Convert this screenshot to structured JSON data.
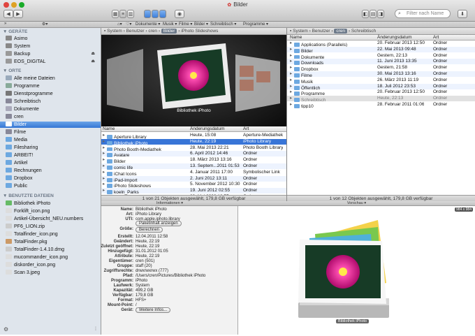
{
  "window": {
    "title": "Bilder"
  },
  "toolbar": {
    "back": "◀",
    "forward": "▶",
    "search_placeholder": "Filter nach Name"
  },
  "favbar": {
    "items": [
      "Dokumente ▾",
      "Musik ▾",
      "Filme ▾",
      "Bilder ▾",
      "Schreibtisch ▾",
      "Programme ▾"
    ]
  },
  "sidebar": {
    "sections": [
      {
        "title": "▼ GERÄTE",
        "items": [
          "Asimo",
          "System",
          "Backup",
          "EOS_DIGITAL"
        ]
      },
      {
        "title": "▼ ORTE",
        "items": [
          "Alle meine Dateien",
          "Programme",
          "Dienstprogramme",
          "Schreibtisch",
          "Dokumente",
          "cren",
          "Bilder",
          "Filme",
          "Media",
          "Filesharing",
          "ARBEIT!",
          "Artikel",
          "Rechnungen",
          "Dropbox",
          "Public"
        ]
      },
      {
        "title": "▼ BENUTZTE DATEIEN",
        "items": [
          "Bibliothek iPhoto",
          "Forklift_icon.png",
          "Artikel-Übersicht_NEU.numbers",
          "PF6_LION.zip",
          "Totalfinder_icon.png",
          "TotalFinder.pkg",
          "TotalFinder-1.4.10.dmg",
          "mucommander_icon.png",
          "diskorder_icon.png",
          "Scan 3.jpeg"
        ]
      }
    ],
    "selected": "Bilder"
  },
  "left_pane": {
    "breadcrumb": [
      "System",
      "Benutzer",
      "cren",
      "Bilder",
      "iPhoto Slideshows"
    ],
    "preview_caption": "Bibliothek iPhoto",
    "columns": [
      "Name",
      "Änderungsdatum",
      "Art"
    ],
    "rows": [
      [
        "Aperture Library",
        "Heute, 15:08",
        "Aperture-Mediathek"
      ],
      [
        "Bibliothek iPhoto",
        "Heute, 22:19",
        "iPhoto Library"
      ],
      [
        "Photo Booth-Mediathek",
        "28. Mai 2013 22:21",
        "Photo Booth Library"
      ],
      [
        "Avatare",
        "6. April 2012 14:46",
        "Ordner"
      ],
      [
        "Bilder",
        "18. März 2013 13:16",
        "Ordner"
      ],
      [
        "comic life",
        "13. Septem...2011 01:53",
        "Ordner"
      ],
      [
        "iChat Icons",
        "4. Januar 2011 17:00",
        "Symbolischer Link"
      ],
      [
        "iPad-Import",
        "2. Juni 2012 13:11",
        "Ordner"
      ],
      [
        "iPhoto Slideshows",
        "5. November 2012 10:30",
        "Ordner"
      ],
      [
        "koeln_Parks",
        "19. Juni 2012 02:55",
        "Ordner"
      ],
      [
        "Passbilder",
        "29. Mai 2009 12:55",
        "Ordner"
      ]
    ],
    "status": "1 von 21 Objekten ausgewählt, 179,8 GB verfügbar"
  },
  "right_pane": {
    "breadcrumb": [
      "System",
      "Benutzer",
      "cren",
      "Schreibtisch"
    ],
    "columns": [
      "Name",
      "Änderungsdatum",
      "Art"
    ],
    "rows": [
      [
        "Applications (Parallels)",
        "20. Februar 2013 12:50",
        "Ordner"
      ],
      [
        "Bilder",
        "22. Mai 2013 09:48",
        "Ordner"
      ],
      [
        "Dokumente",
        "Gestern, 22:13",
        "Ordner"
      ],
      [
        "Downloads",
        "11. Juni 2013 13:35",
        "Ordner"
      ],
      [
        "Dropbox",
        "Gestern, 21:58",
        "Ordner"
      ],
      [
        "Filme",
        "30. Mai 2013 13:16",
        "Ordner"
      ],
      [
        "Musik",
        "26. März 2013 11:19",
        "Ordner"
      ],
      [
        "Öffentlich",
        "18. Juli 2012 23:53",
        "Ordner"
      ],
      [
        "Programme",
        "20. Februar 2013 12:50",
        "Ordner"
      ],
      [
        "Schreibtisch",
        "Heute, 22:13",
        "Ordner"
      ],
      [
        "tipp10",
        "28. Februar 2011 01:06",
        "Ordner"
      ],
      [
        "Websites",
        "7. April 2012 11:56",
        "Ordner"
      ]
    ],
    "status": "1 von 12 Objekten ausgewählt, 179,8 GB verfügbar"
  },
  "info": {
    "title": "Informationen ▾",
    "fields": [
      [
        "Name:",
        "Bibliothek iPhoto"
      ],
      [
        "Art:",
        "iPhoto Library"
      ],
      [
        "UTI:",
        "com.apple.iphoto.library"
      ],
      [
        "Größe:",
        ""
      ],
      [
        "Erstellt:",
        "12.04.2011 12:58"
      ],
      [
        "Geändert:",
        "Heute, 22:19"
      ],
      [
        "Zuletzt geöffnet:",
        "Heute, 22:19"
      ],
      [
        "Hinzugefügt:",
        "31.01.2012 01:05"
      ],
      [
        "Attribute:",
        "Heute, 22:19"
      ],
      [
        "Eigentümer:",
        "cren (501)"
      ],
      [
        "Gruppe:",
        "staff (20)"
      ],
      [
        "Zugriffsrechte:",
        "drwxrwxrwx (777)"
      ],
      [
        "Pfad:",
        "/Users/cren/Pictures/Bibliothek iPhoto"
      ],
      [
        "Programm:",
        "iPhoto"
      ],
      [
        "Laufwerk:",
        "System"
      ],
      [
        "Kapazität:",
        "499,2 GB"
      ],
      [
        "Verfügbar:",
        "179,8 GB"
      ],
      [
        "Format:",
        "HFS+"
      ],
      [
        "Mount-Point:",
        "/"
      ],
      [
        "Gerät:",
        "/dev/disk0s2"
      ]
    ],
    "btn_paket": "Paketinhalt anzeigen",
    "btn_berechnen": "Berechnen",
    "btn_more": "Weitere Infos..."
  },
  "vorschau": {
    "title": "Vorschau ▾",
    "size_badge": "984 x 984",
    "caption": "Bibliothek iPhoto"
  }
}
